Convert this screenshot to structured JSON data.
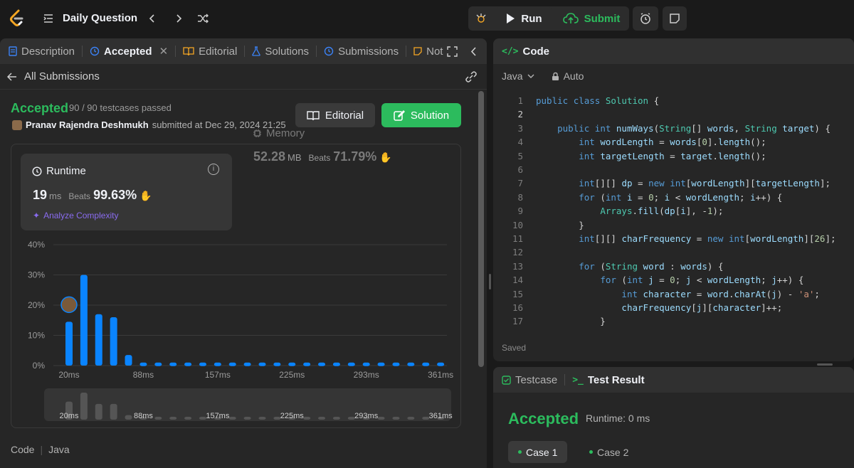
{
  "topbar": {
    "title": "Daily Question",
    "run_label": "Run",
    "submit_label": "Submit"
  },
  "left_tabs": [
    "Description",
    "Accepted",
    "Editorial",
    "Solutions",
    "Submissions",
    "Not"
  ],
  "all_submissions_label": "All Submissions",
  "result": {
    "status": "Accepted",
    "passed": "90 / 90 testcases passed",
    "user": "Pranav Rajendra Deshmukh",
    "submitted_text": "submitted at Dec 29, 2024 21:25",
    "editorial_label": "Editorial",
    "solution_label": "Solution"
  },
  "runtime": {
    "label": "Runtime",
    "value": "19",
    "unit": "ms",
    "beats_label": "Beats",
    "beats": "99.63%",
    "analyze_label": "Analyze Complexity"
  },
  "memory": {
    "label": "Memory",
    "value": "52.28",
    "unit": "MB",
    "beats_label": "Beats",
    "beats": "71.79%"
  },
  "chart_data": {
    "type": "bar",
    "title": "",
    "xlabel": "",
    "ylabel": "",
    "ylim": [
      0,
      40
    ],
    "y_ticks": [
      "40%",
      "30%",
      "20%",
      "10%",
      "0%"
    ],
    "x_tick_labels": [
      "20ms",
      "88ms",
      "157ms",
      "225ms",
      "293ms",
      "361ms"
    ],
    "values": [
      14.5,
      30,
      17,
      16,
      3.5,
      1,
      1,
      1,
      1,
      1,
      1,
      1,
      1,
      1,
      1,
      1,
      1,
      1,
      1,
      1,
      1,
      1,
      1,
      1,
      1,
      1
    ],
    "user_bar_index": 0,
    "bar_color": "#0a84ff",
    "grid": true,
    "mini_values": [
      8,
      12,
      7,
      7,
      2,
      1,
      1,
      1,
      1,
      1,
      1,
      1,
      1,
      1,
      1,
      1,
      1,
      1,
      1,
      1,
      1,
      1,
      1,
      1,
      1,
      1
    ],
    "mini_tick_labels": [
      "20ms",
      "88ms",
      "157ms",
      "225ms",
      "293ms",
      "361ms"
    ]
  },
  "code_footer": {
    "label": "Code",
    "lang": "Java"
  },
  "code_panel": {
    "title": "Code",
    "language": "Java",
    "mode": "Auto",
    "saved": "Saved"
  },
  "code_lines": [
    "public class Solution {",
    "",
    "    public int numWays(String[] words, String target) {",
    "        int wordLength = words[0].length();",
    "        int targetLength = target.length();",
    "",
    "        int[][] dp = new int[wordLength][targetLength];",
    "        for (int i = 0; i < wordLength; i++) {",
    "            Arrays.fill(dp[i], -1);",
    "        }",
    "        int[][] charFrequency = new int[wordLength][26];",
    "",
    "        for (String word : words) {",
    "            for (int j = 0; j < wordLength; j++) {",
    "                int character = word.charAt(j) - 'a';",
    "                charFrequency[j][character]++;",
    "            }"
  ],
  "test_panel": {
    "tab_testcase": "Testcase",
    "tab_result": "Test Result",
    "status": "Accepted",
    "runtime": "Runtime: 0 ms",
    "case1": "Case 1",
    "case2": "Case 2"
  },
  "colors": {
    "accent_green": "#2cbb5d",
    "bar_blue": "#0a84ff",
    "purple": "#8a6cf0"
  }
}
